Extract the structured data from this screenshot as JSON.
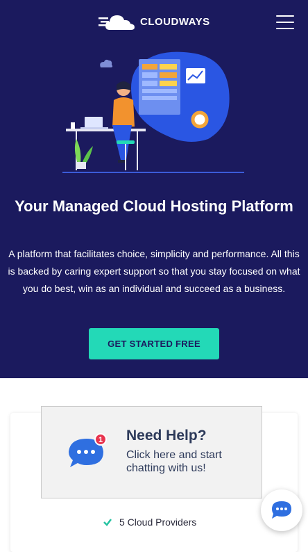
{
  "brand": {
    "name": "CLOUDWAYS"
  },
  "hero": {
    "title": "Your Managed Cloud Hosting Platform",
    "description": "A platform that facilitates choice, simplicity and performance. All this is backed by caring expert support so that you stay focused on what you do best, win as an individual and succeed as a business.",
    "cta_label": "GET STARTED FREE"
  },
  "features": {
    "first_item": "5 Cloud Providers"
  },
  "help_popup": {
    "badge_count": "1",
    "title": "Need Help?",
    "subtitle": "Click here and start chatting with us!"
  },
  "colors": {
    "hero_bg": "#1b1a5e",
    "accent": "#23d9b7",
    "chat_blue": "#2f6fe0",
    "badge_red": "#e8344e"
  }
}
